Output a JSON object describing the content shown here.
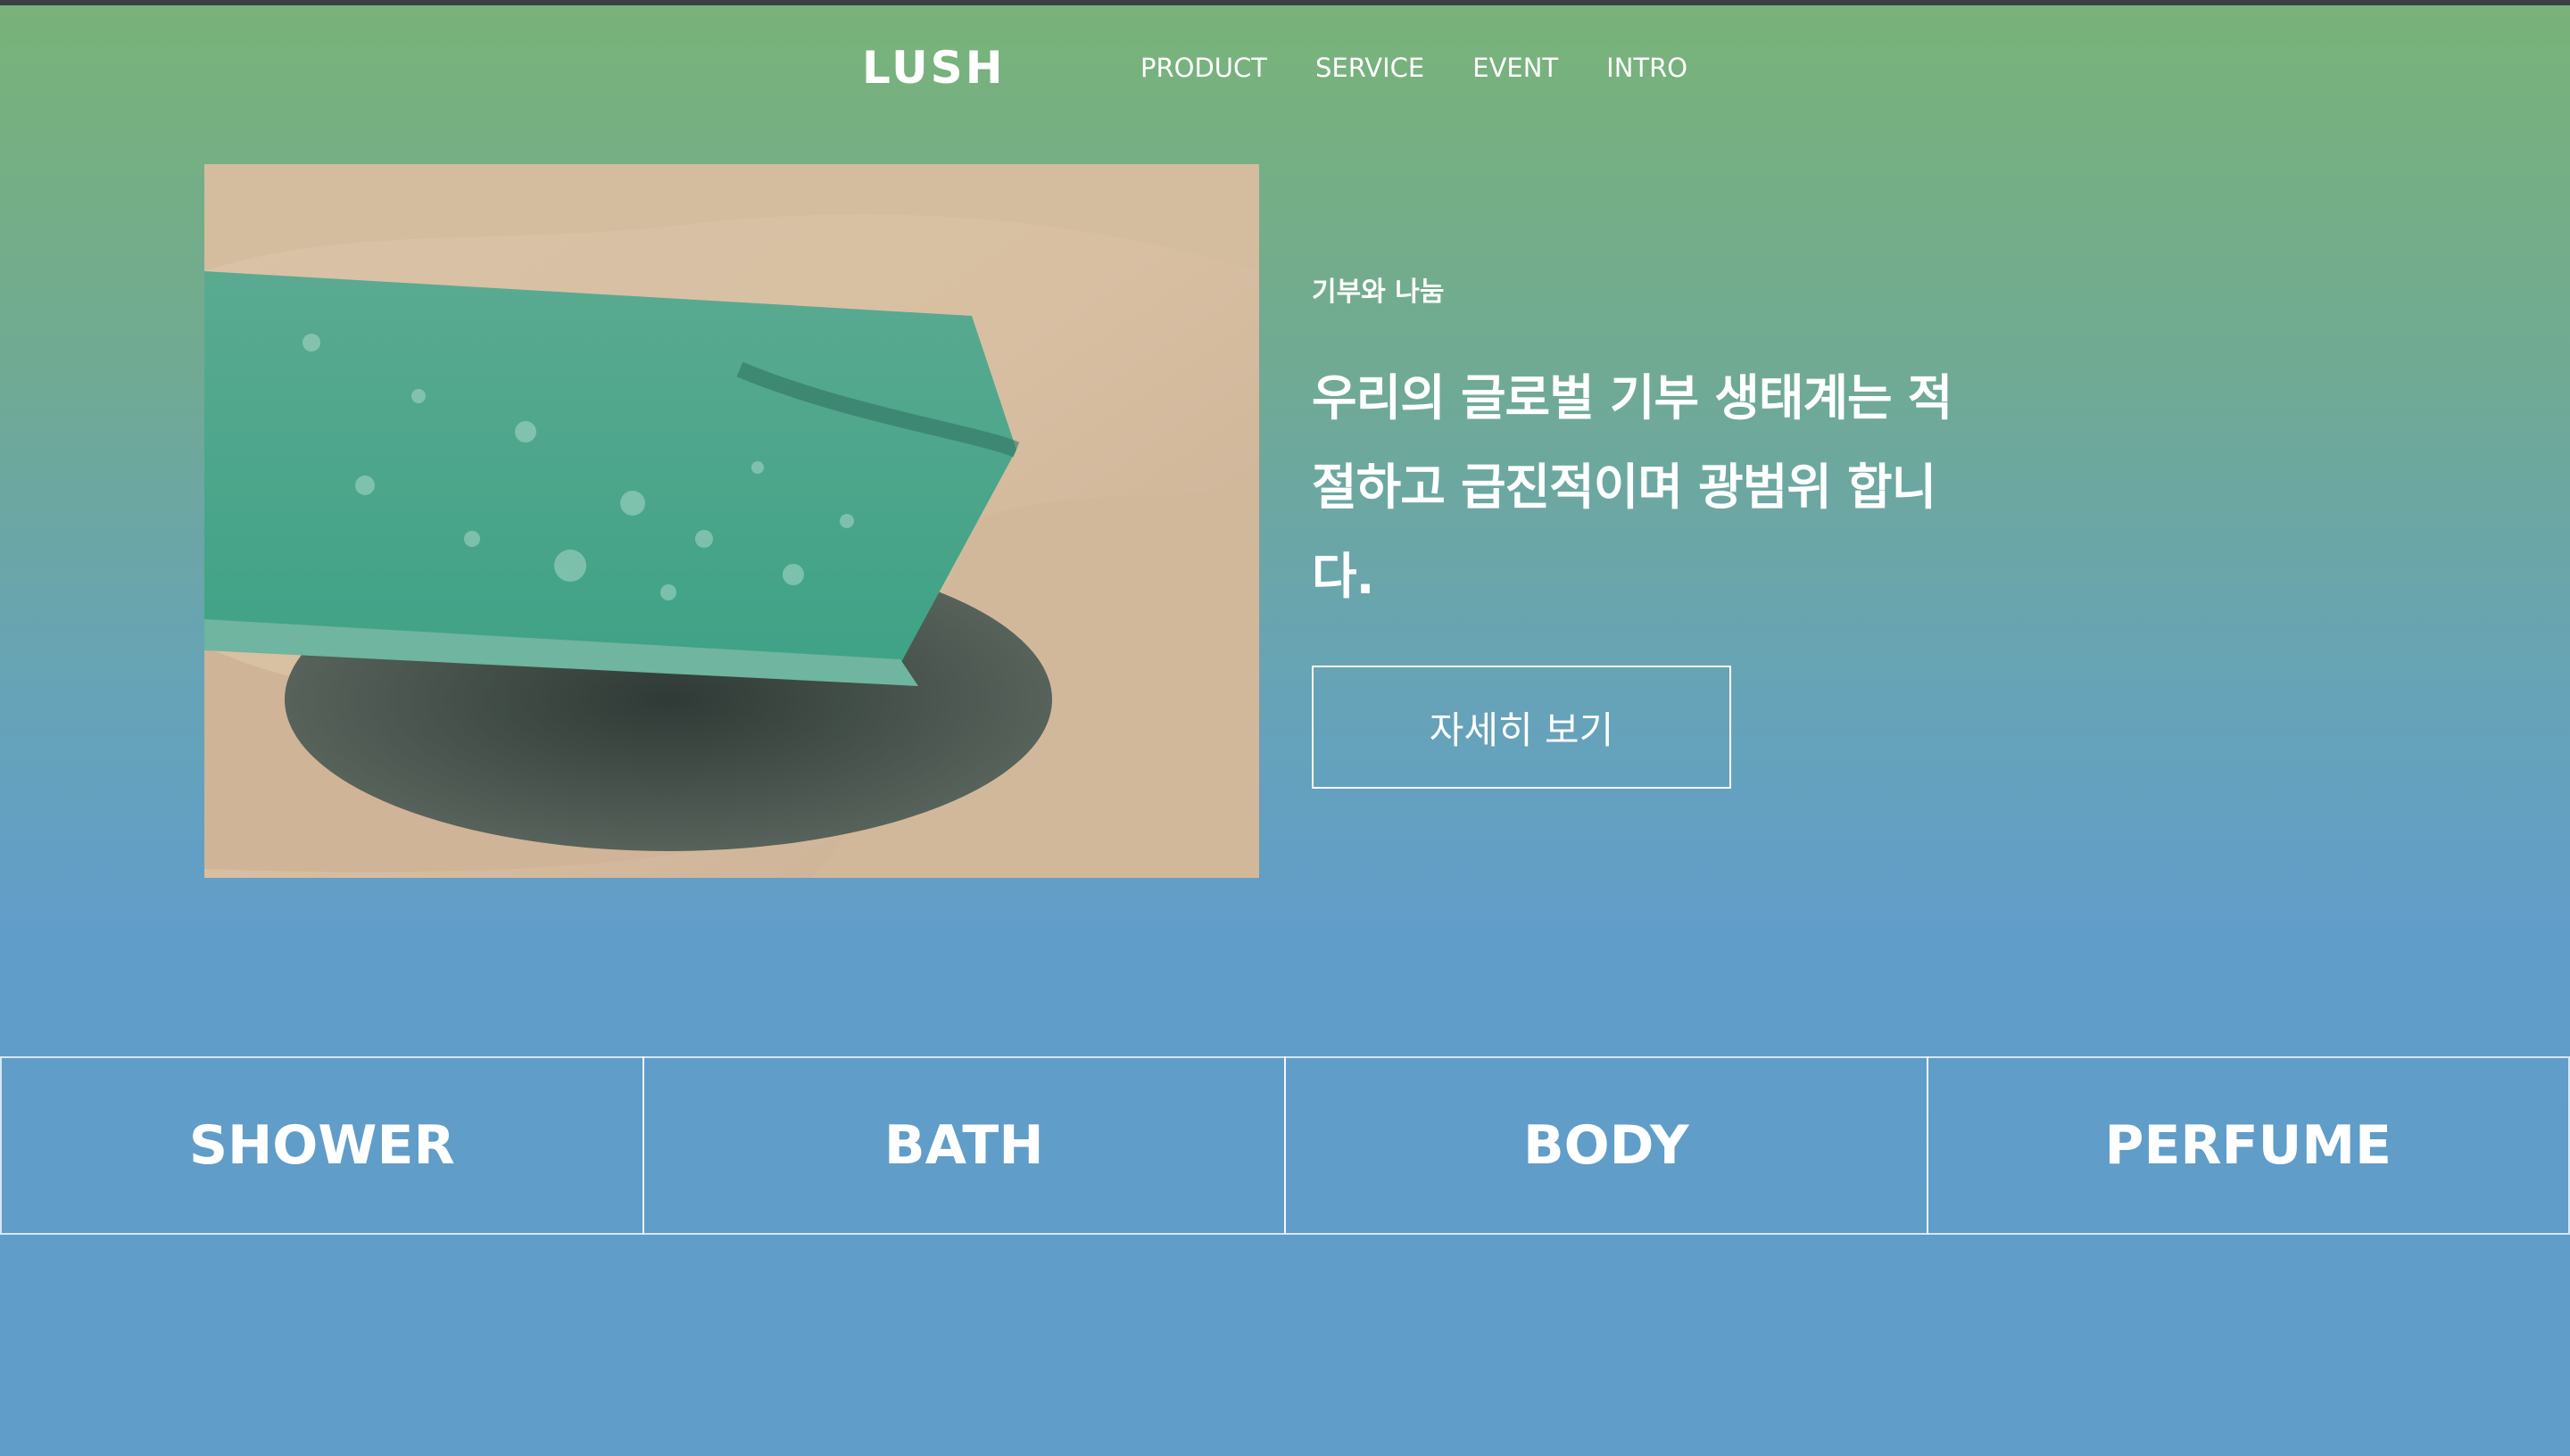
{
  "brand": {
    "logo": "LUSH"
  },
  "nav": {
    "items": [
      {
        "label": "PRODUCT"
      },
      {
        "label": "SERVICE"
      },
      {
        "label": "EVENT"
      },
      {
        "label": "INTRO"
      }
    ]
  },
  "hero": {
    "image_icon": "soap-bar-in-hands-photo",
    "eyebrow": "기부와 나눔",
    "headline": "우리의 글로벌 기부 생태계는 적절하고 급진적이며 광범위 합니다.",
    "button_label": "자세히 보기"
  },
  "categories": [
    {
      "label": "SHOWER"
    },
    {
      "label": "BATH"
    },
    {
      "label": "BODY"
    },
    {
      "label": "PERFUME"
    }
  ],
  "colors": {
    "gradient_top": "#79b378",
    "gradient_bottom": "#609dc8",
    "top_strip": "#3b4047",
    "text": "#ffffff"
  }
}
